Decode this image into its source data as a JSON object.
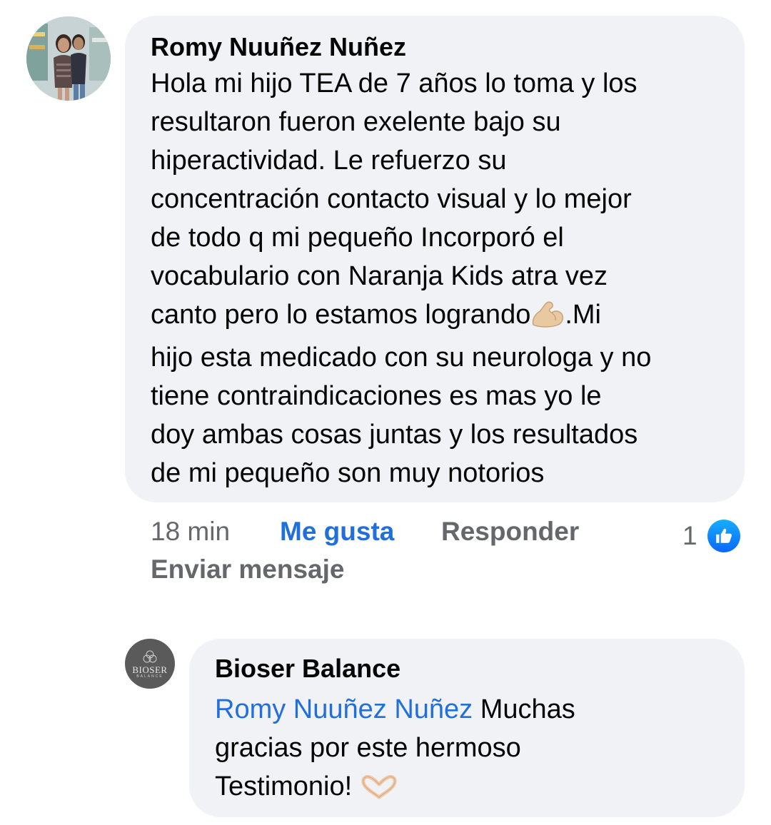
{
  "comment": {
    "author": "Romy Nuuñez Nuñez",
    "text_before_emoji": "Hola mi hijo TEA de 7 años lo toma y los\nresultaron fueron exelente bajo su\nhiperactividad. Le refuerzo su\nconcentración contacto visual y lo mejor\nde todo q mi pequeño Incorporó el\nvocabulario con Naranja Kids atra vez\ncanto pero lo estamos logrando",
    "emoji": "flexed-biceps-emoji",
    "text_after_emoji": ".Mi\nhijo esta medicado con su neurologa y no\ntiene contraindicaciones es mas yo le\ndoy ambas cosas juntas y los resultados\nde mi pequeño son muy notorios",
    "time": "18 min",
    "like_label": "Me gusta",
    "reply_label": "Responder",
    "send_message_label": "Enviar mensaje",
    "reaction_count": "1",
    "reaction_icon": "like-icon",
    "like_color": "#216fdb"
  },
  "reply": {
    "author": "Bioser Balance",
    "avatar_text": "BIOSER",
    "avatar_subtext": "BALANCE",
    "mention": "Romy Nuuñez Nuñez",
    "text_line1": " Muchas\ngracias por este hermoso\nTestimonio! ",
    "emoji": "heart-hands-emoji",
    "mention_color": "#216fdb"
  },
  "colors": {
    "bubble_bg": "#f0f2f5",
    "secondary_text": "#65676b"
  }
}
